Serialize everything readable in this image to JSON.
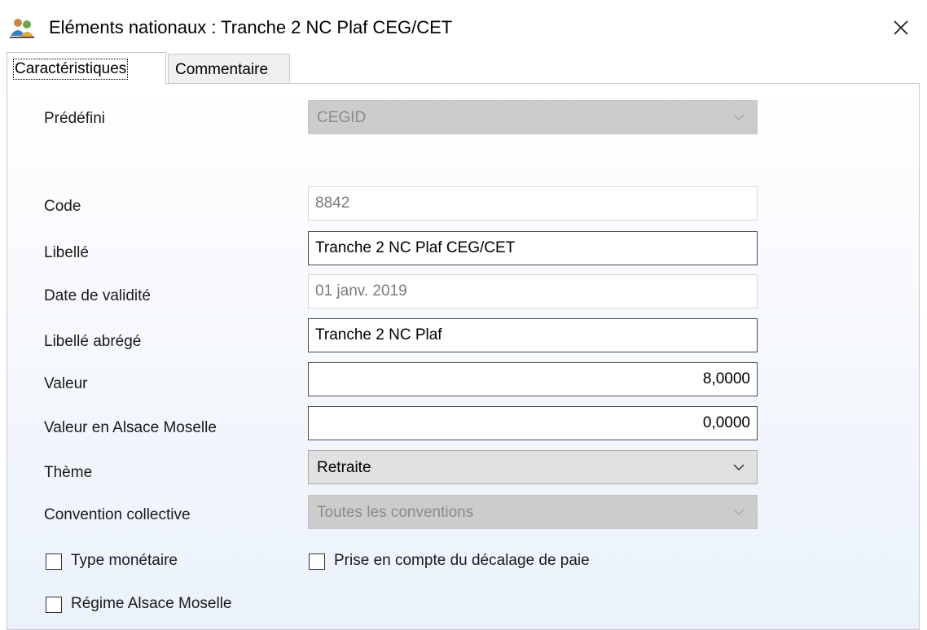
{
  "window": {
    "title": "Eléments nationaux :  Tranche 2 NC Plaf CEG/CET",
    "app_icon": "people-icon",
    "close_icon": "close-icon"
  },
  "tabs": [
    {
      "label": "Caractéristiques",
      "active": true
    },
    {
      "label": "Commentaire",
      "active": false
    }
  ],
  "form": {
    "predefini": {
      "label": "Prédéfini",
      "value": "CEGID"
    },
    "code": {
      "label": "Code",
      "value": "8842"
    },
    "libelle": {
      "label": "Libellé",
      "value": "Tranche 2 NC Plaf CEG/CET"
    },
    "date_validite": {
      "label": "Date de validité",
      "value": "01 janv. 2019"
    },
    "libelle_abrege": {
      "label": "Libellé abrégé",
      "value": "Tranche 2 NC Plaf"
    },
    "valeur": {
      "label": "Valeur",
      "value": "8,0000"
    },
    "valeur_alsace": {
      "label": "Valeur en Alsace Moselle",
      "value": "0,0000"
    },
    "theme": {
      "label": "Thème",
      "value": "Retraite"
    },
    "convention": {
      "label": "Convention collective",
      "value": "Toutes les conventions"
    }
  },
  "checkboxes": {
    "type_monetaire": {
      "label": "Type monétaire",
      "checked": false
    },
    "prise_en_compte": {
      "label": "Prise en compte du décalage de paie",
      "checked": false
    },
    "regime_alsace": {
      "label": "Régime Alsace Moselle",
      "checked": false
    }
  }
}
